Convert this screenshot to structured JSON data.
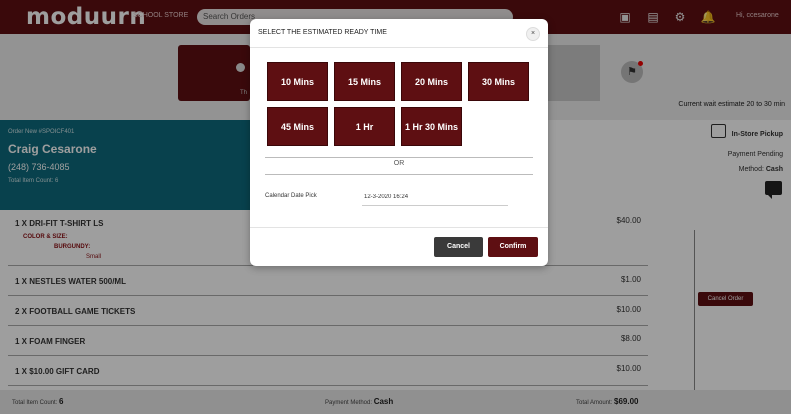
{
  "header": {
    "logo": "moduurn",
    "store": "SCHOOL STORE",
    "search_placeholder": "Search Orders",
    "greeting": "Hi, ccesarone"
  },
  "status": {
    "partial_label": "Th",
    "wait_estimate": "Current wait estimate 20 to 30 min"
  },
  "order": {
    "order_number": "Order New #SPOICF401",
    "customer_name": "Craig Cesarone",
    "phone": "(248) 736-4085",
    "item_count_label": "Total Item Count: 6",
    "pickup": "In-Store Pickup",
    "payment_status": "Payment Pending",
    "method_label": "Method:",
    "method_value": "Cash",
    "cancel_order": "Cancel Order"
  },
  "items": [
    {
      "name": "1 X DRI-FIT T-SHIRT LS",
      "price": "$40.00"
    },
    {
      "name": "1 X NESTLES WATER 500/ML",
      "price": "$1.00"
    },
    {
      "name": "2 X FOOTBALL GAME TICKETS",
      "price": "$10.00"
    },
    {
      "name": "1 X FOAM FINGER",
      "price": "$8.00"
    },
    {
      "name": "1 X $10.00 GIFT CARD",
      "price": "$10.00"
    }
  ],
  "item_options": {
    "header": "COLOR & SIZE:",
    "color": "BURGUNDY:",
    "size": "Small"
  },
  "footer": {
    "count_label": "Total Item Count:",
    "count_value": "6",
    "payment_label": "Payment Method:",
    "payment_value": "Cash",
    "total_label": "Total Amount:",
    "total_value": "$69.00"
  },
  "modal": {
    "title": "SELECT THE ESTIMATED READY TIME",
    "close": "×",
    "time_options": [
      "10 Mins",
      "15 Mins",
      "20 Mins",
      "30 Mins",
      "45 Mins",
      "1 Hr",
      "1 Hr 30 Mins"
    ],
    "or_text": "OR",
    "calendar_label": "Calendar Date Pick",
    "calendar_value": "12-3-2020 16:24",
    "cancel_label": "Cancel",
    "confirm_label": "Confirm"
  },
  "colors": {
    "brand": "#5e0f12",
    "teal": "#0e6a7c",
    "cancel_dark": "#3a3a3a"
  }
}
